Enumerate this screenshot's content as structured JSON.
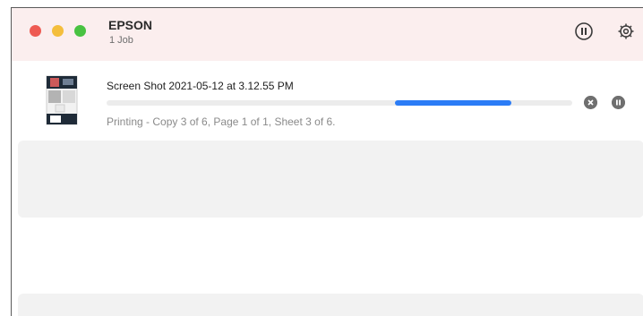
{
  "window": {
    "title": "EPSON",
    "subtitle": "1 Job",
    "toolbar": {
      "pause_icon": "pause-circle-icon",
      "settings_icon": "gear-icon"
    }
  },
  "job": {
    "name": "Screen Shot 2021-05-12 at 3.12.55 PM",
    "status": "Printing - Copy 3 of 6, Page 1 of 1, Sheet 3 of 6.",
    "progress": {
      "start": 0.62,
      "end": 0.87
    },
    "thumbnail_icon": "document-thumbnail-icon",
    "cancel_icon": "cancel-x-icon",
    "hold_icon": "pause-job-icon"
  },
  "colors": {
    "titlebar_bg": "#fbeeee",
    "progress_accent": "#2b7cf6",
    "close": "#ee5a52",
    "minimize": "#f4be3c",
    "maximize": "#48c241"
  }
}
